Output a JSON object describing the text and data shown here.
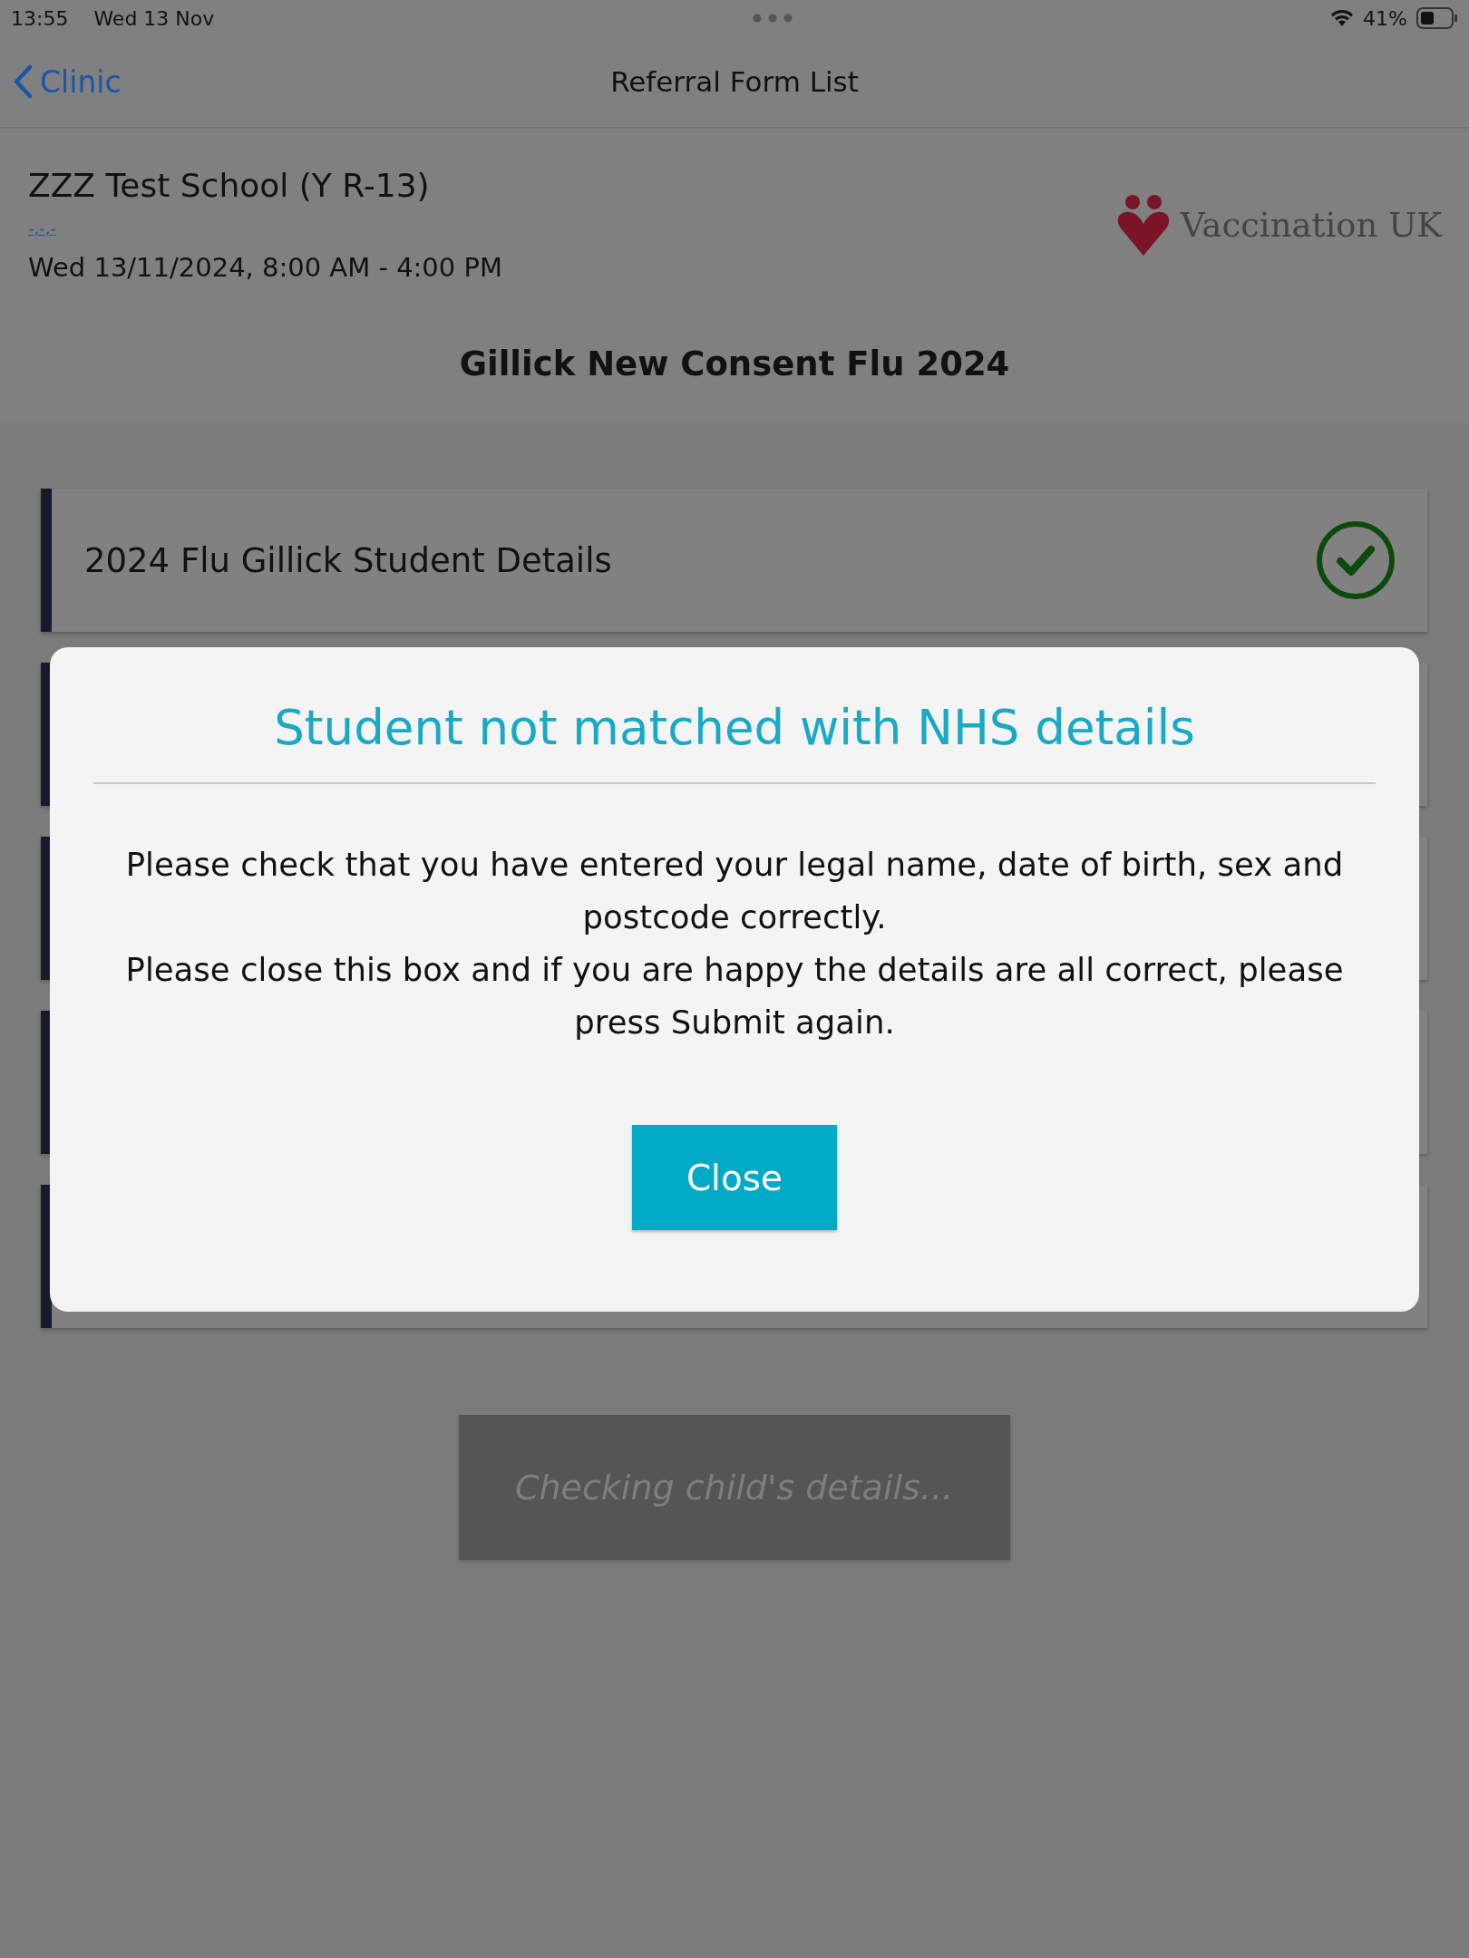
{
  "status_bar": {
    "time": "13:55",
    "date": "Wed 13 Nov",
    "battery": "41%"
  },
  "nav": {
    "back": "Clinic",
    "title": "Referral Form List"
  },
  "clinic": {
    "school": "ZZZ Test School (Y R-13)",
    "link": "-,-,-",
    "datetime": "Wed 13/11/2024, 8:00 AM - 4:00 PM",
    "logo_text": "Vaccination UK"
  },
  "form_title": "Gillick New Consent Flu 2024",
  "sections": [
    {
      "label": "2024 Flu Gillick Student Details",
      "completed": true
    }
  ],
  "submit": {
    "label": "Checking child's details...",
    "disabled": true
  },
  "dialog": {
    "title": "Student not matched with NHS details",
    "lines": [
      "Please check that you have entered your legal name, date of birth, sex and postcode correctly.",
      "Please close this box and if you are happy the details are all correct, please press Submit again."
    ],
    "button": "Close"
  }
}
